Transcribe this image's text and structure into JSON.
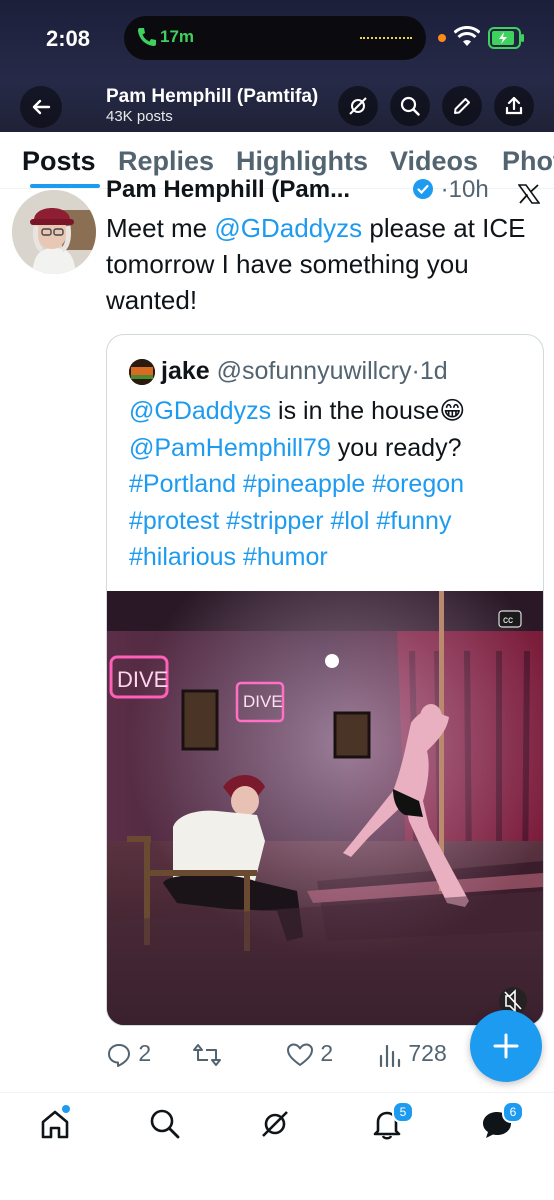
{
  "status_bar": {
    "time": "2:08",
    "call_timer": "17m"
  },
  "header": {
    "profile_name": "Pam Hemphill (Pamtifa)",
    "post_count": "43K posts"
  },
  "tabs": [
    {
      "label": "Posts",
      "active": true
    },
    {
      "label": "Replies",
      "active": false
    },
    {
      "label": "Highlights",
      "active": false
    },
    {
      "label": "Videos",
      "active": false
    },
    {
      "label": "Photos",
      "active": false
    }
  ],
  "post": {
    "author": "Pam Hemphill (Pam...",
    "time": "10h",
    "text_1": "Meet me ",
    "mention": "@GDaddyzs",
    "text_2": " please at ICE tomorrow I have something you wanted!",
    "quoted": {
      "author": "jake",
      "handle": "@sofunnyuwillcry",
      "time": "1d",
      "mention_1": "@GDaddyzs",
      "text_1": " is in the house",
      "emoji": "😁",
      "mention_2": "@PamHemphill79",
      "text_2": " you ready?",
      "hashtags": [
        "#Portland",
        "#pineapple",
        "#oregon",
        "#protest",
        "#stripper",
        "#lol",
        "#funny",
        "#hilarious",
        "#humor"
      ],
      "media": {
        "sign_1": "DIVE",
        "sign_2": "DIVE",
        "cc_badge": "cc"
      }
    },
    "replies": "2",
    "likes": "2",
    "views": "728"
  },
  "bottom_nav": {
    "notifications_badge": "5",
    "messages_badge": "6"
  },
  "colors": {
    "accent": "#1d9bf0",
    "text": "#0f1419",
    "muted": "#536471"
  }
}
